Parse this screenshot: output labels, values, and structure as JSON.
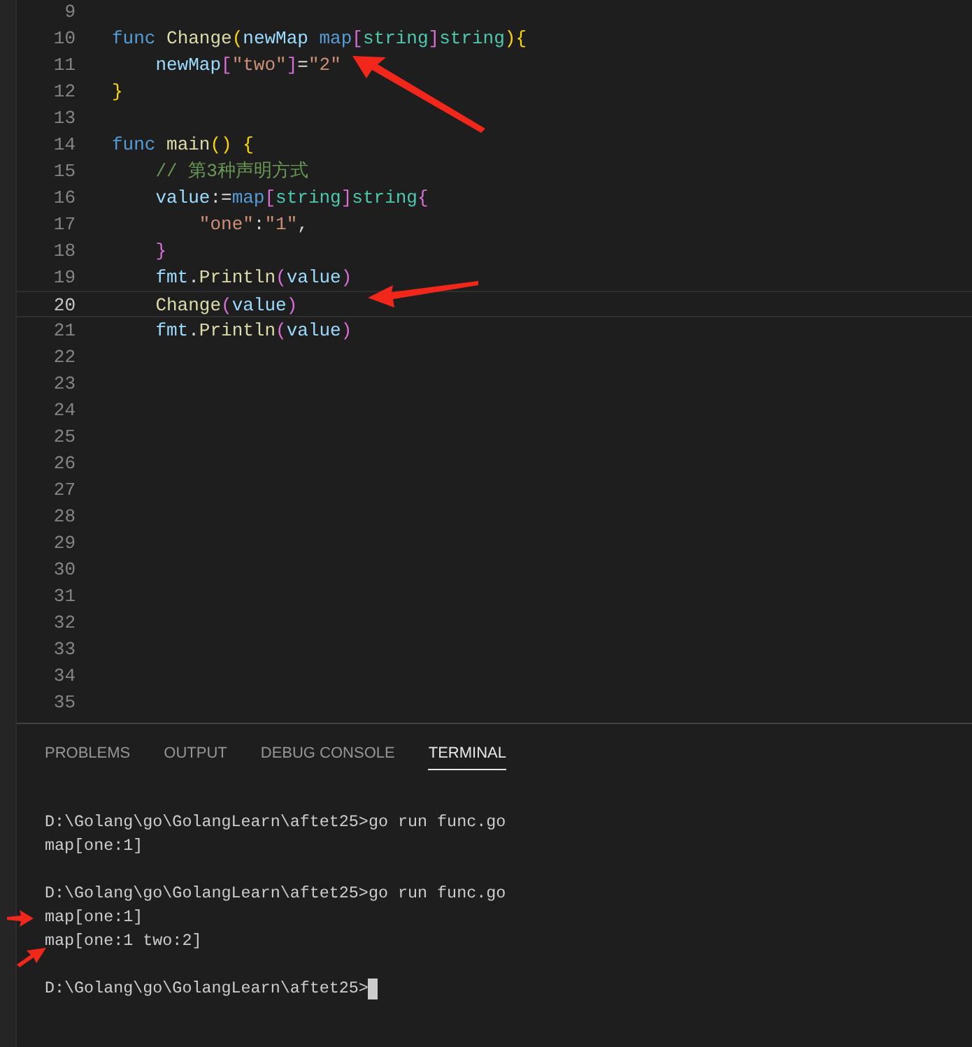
{
  "editor": {
    "lines": [
      {
        "number": "9",
        "current": false
      },
      {
        "number": "10",
        "current": false,
        "tokens": [
          {
            "kind": "keyword",
            "text": "func "
          },
          {
            "kind": "function",
            "text": "Change"
          },
          {
            "kind": "bracket-gold",
            "text": "("
          },
          {
            "kind": "variable",
            "text": "newMap "
          },
          {
            "kind": "keyword",
            "text": "map"
          },
          {
            "kind": "bracket-pink",
            "text": "["
          },
          {
            "kind": "type",
            "text": "string"
          },
          {
            "kind": "bracket-pink",
            "text": "]"
          },
          {
            "kind": "type",
            "text": "string"
          },
          {
            "kind": "bracket-gold",
            "text": "){"
          }
        ]
      },
      {
        "number": "11",
        "current": false,
        "tokens": [
          {
            "kind": "variable",
            "text": "    newMap"
          },
          {
            "kind": "bracket-pink",
            "text": "["
          },
          {
            "kind": "string",
            "text": "\"two\""
          },
          {
            "kind": "bracket-pink",
            "text": "]"
          },
          {
            "kind": "plain",
            "text": "="
          },
          {
            "kind": "string",
            "text": "\"2\""
          }
        ]
      },
      {
        "number": "12",
        "current": false,
        "tokens": [
          {
            "kind": "bracket-gold",
            "text": "}"
          }
        ]
      },
      {
        "number": "13",
        "current": false
      },
      {
        "number": "14",
        "current": false,
        "tokens": [
          {
            "kind": "keyword",
            "text": "func "
          },
          {
            "kind": "function",
            "text": "main"
          },
          {
            "kind": "bracket-gold",
            "text": "() {"
          }
        ]
      },
      {
        "number": "15",
        "current": false,
        "tokens": [
          {
            "kind": "comment",
            "text": "    // 第3种声明方式"
          }
        ]
      },
      {
        "number": "16",
        "current": false,
        "tokens": [
          {
            "kind": "variable",
            "text": "    value"
          },
          {
            "kind": "plain",
            "text": ":="
          },
          {
            "kind": "keyword",
            "text": "map"
          },
          {
            "kind": "bracket-pink",
            "text": "["
          },
          {
            "kind": "type",
            "text": "string"
          },
          {
            "kind": "bracket-pink",
            "text": "]"
          },
          {
            "kind": "type",
            "text": "string"
          },
          {
            "kind": "bracket-pink",
            "text": "{"
          }
        ]
      },
      {
        "number": "17",
        "current": false,
        "tokens": [
          {
            "kind": "string",
            "text": "        \"one\""
          },
          {
            "kind": "plain",
            "text": ":"
          },
          {
            "kind": "string",
            "text": "\"1\""
          },
          {
            "kind": "plain",
            "text": ","
          }
        ]
      },
      {
        "number": "18",
        "current": false,
        "tokens": [
          {
            "kind": "bracket-pink",
            "text": "    }"
          }
        ]
      },
      {
        "number": "19",
        "current": false,
        "tokens": [
          {
            "kind": "variable",
            "text": "    fmt"
          },
          {
            "kind": "plain",
            "text": "."
          },
          {
            "kind": "function",
            "text": "Println"
          },
          {
            "kind": "bracket-pink",
            "text": "("
          },
          {
            "kind": "variable",
            "text": "value"
          },
          {
            "kind": "bracket-pink",
            "text": ")"
          }
        ]
      },
      {
        "number": "20",
        "current": true,
        "tokens": [
          {
            "kind": "function",
            "text": "    Change"
          },
          {
            "kind": "bracket-pink",
            "text": "("
          },
          {
            "kind": "variable",
            "text": "value"
          },
          {
            "kind": "bracket-pink",
            "text": ")"
          }
        ]
      },
      {
        "number": "21",
        "current": false,
        "tokens": [
          {
            "kind": "variable",
            "text": "    fmt"
          },
          {
            "kind": "plain",
            "text": "."
          },
          {
            "kind": "function",
            "text": "Println"
          },
          {
            "kind": "bracket-pink",
            "text": "("
          },
          {
            "kind": "variable",
            "text": "value"
          },
          {
            "kind": "bracket-pink",
            "text": ")"
          }
        ]
      },
      {
        "number": "22",
        "current": false
      },
      {
        "number": "23",
        "current": false
      },
      {
        "number": "24",
        "current": false
      },
      {
        "number": "25",
        "current": false
      },
      {
        "number": "26",
        "current": false
      },
      {
        "number": "27",
        "current": false
      },
      {
        "number": "28",
        "current": false
      },
      {
        "number": "29",
        "current": false
      },
      {
        "number": "30",
        "current": false
      },
      {
        "number": "31",
        "current": false
      },
      {
        "number": "32",
        "current": false
      },
      {
        "number": "33",
        "current": false
      },
      {
        "number": "34",
        "current": false
      },
      {
        "number": "35",
        "current": false
      }
    ]
  },
  "panel": {
    "tabs": [
      {
        "label": "PROBLEMS",
        "selected": false
      },
      {
        "label": "OUTPUT",
        "selected": false
      },
      {
        "label": "DEBUG CONSOLE",
        "selected": false
      },
      {
        "label": "TERMINAL",
        "selected": true
      }
    ],
    "terminal": [
      {
        "kind": "blank"
      },
      {
        "kind": "output",
        "text": "D:\\Golang\\go\\GolangLearn\\aftet25>go run func.go",
        "cursor": false
      },
      {
        "kind": "output",
        "text": "map[one:1]",
        "cursor": false
      },
      {
        "kind": "blank"
      },
      {
        "kind": "output",
        "text": "D:\\Golang\\go\\GolangLearn\\aftet25>go run func.go",
        "cursor": false
      },
      {
        "kind": "output",
        "text": "map[one:1]",
        "cursor": false
      },
      {
        "kind": "output",
        "text": "map[one:1 two:2]",
        "cursor": false
      },
      {
        "kind": "blank"
      },
      {
        "kind": "output",
        "text": "D:\\Golang\\go\\GolangLearn\\aftet25>",
        "cursor": true
      }
    ]
  }
}
